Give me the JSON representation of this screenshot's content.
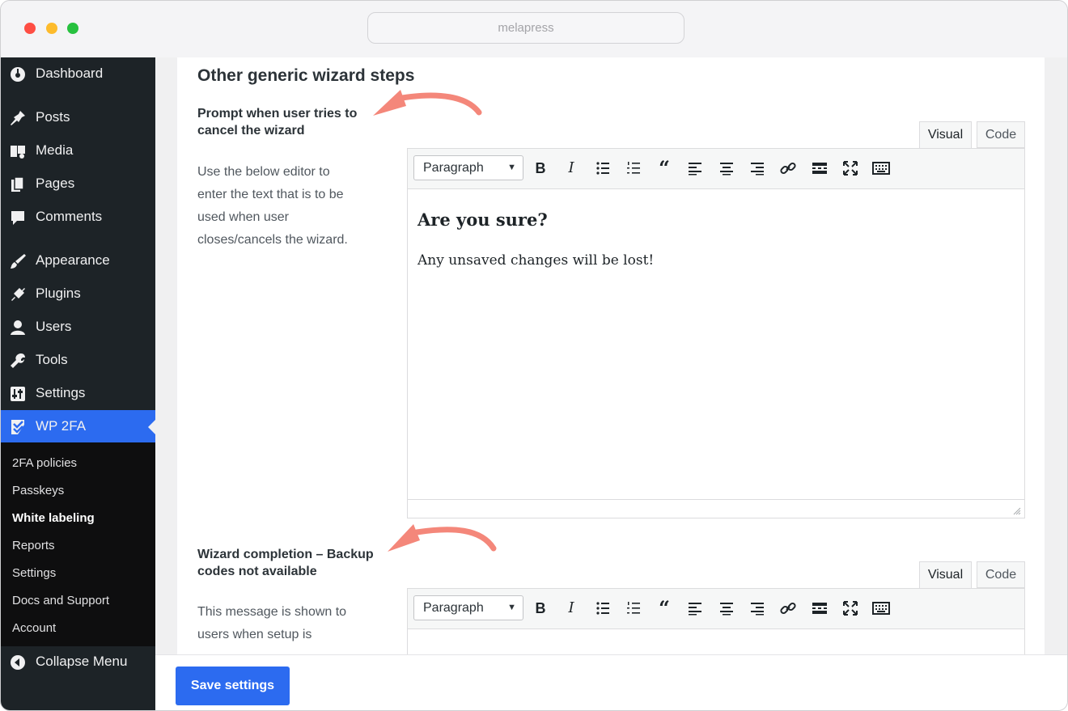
{
  "browser": {
    "url": "melapress"
  },
  "colors": {
    "accent": "#2c6bf0",
    "sidebar": "#1d2327",
    "arrow": "#f4877a"
  },
  "sidebar": {
    "items": [
      {
        "label": "Dashboard",
        "icon": "dashboard-icon"
      },
      {
        "label": "Posts",
        "icon": "pin-icon"
      },
      {
        "label": "Media",
        "icon": "media-icon"
      },
      {
        "label": "Pages",
        "icon": "pages-icon"
      },
      {
        "label": "Comments",
        "icon": "comment-icon"
      },
      {
        "label": "Appearance",
        "icon": "brush-icon"
      },
      {
        "label": "Plugins",
        "icon": "plug-icon"
      },
      {
        "label": "Users",
        "icon": "user-icon"
      },
      {
        "label": "Tools",
        "icon": "wrench-icon"
      },
      {
        "label": "Settings",
        "icon": "settings-icon"
      },
      {
        "label": "WP 2FA",
        "icon": "wp2fa-icon",
        "active": true
      }
    ],
    "submenu": [
      "2FA policies",
      "Passkeys",
      "White labeling",
      "Reports",
      "Settings",
      "Docs and Support",
      "Account"
    ],
    "submenu_current": "White labeling",
    "collapse_label": "Collapse Menu"
  },
  "page": {
    "section_title": "Other generic wizard steps",
    "fields": [
      {
        "label_line1": "Prompt when user tries to",
        "label_line2": "cancel the wizard",
        "desc_lines": [
          "Use the below editor to",
          "enter the text that is to be",
          "used when user",
          "closes/cancels the wizard."
        ],
        "tabs": {
          "visual": "Visual",
          "code": "Code"
        },
        "format": "Paragraph",
        "content_heading": "Are you sure?",
        "content_text": "Any unsaved changes will be lost!"
      },
      {
        "label_line1": "Wizard completion – Backup",
        "label_line2": "codes not available",
        "desc_lines": [
          "This message is shown to",
          "users when setup is"
        ],
        "tabs": {
          "visual": "Visual",
          "code": "Code"
        },
        "format": "Paragraph"
      }
    ]
  },
  "footer": {
    "save_label": "Save settings"
  }
}
